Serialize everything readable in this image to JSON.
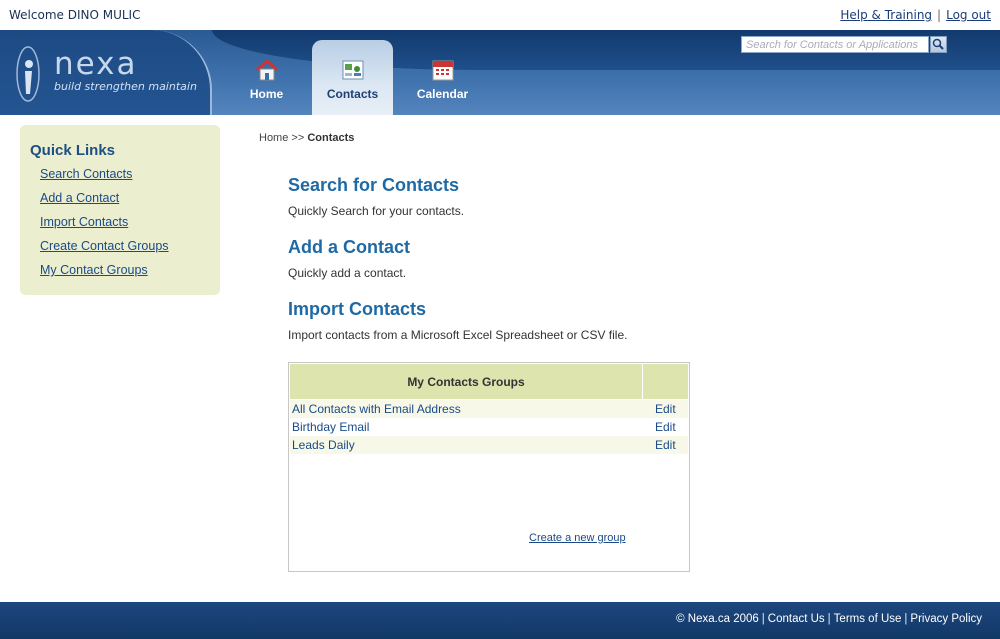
{
  "topbar": {
    "welcome": "Welcome DINO MULIC",
    "help": "Help & Training",
    "separator": "|",
    "logout": "Log out"
  },
  "header": {
    "logo_text": "nexa",
    "logo_tagline": "build strengthen maintain",
    "search_placeholder": "Search for Contacts or Applications",
    "tabs": [
      {
        "label": "Home",
        "icon": "home-icon"
      },
      {
        "label": "Contacts",
        "icon": "contacts-icon",
        "active": true
      },
      {
        "label": "Calendar",
        "icon": "calendar-icon"
      }
    ]
  },
  "sidebar": {
    "title": "Quick Links",
    "items": [
      {
        "label": "Search Contacts"
      },
      {
        "label": "Add a Contact"
      },
      {
        "label": "Import Contacts"
      },
      {
        "label": "Create Contact Groups"
      },
      {
        "label": "My Contact Groups"
      }
    ]
  },
  "breadcrumb": {
    "home": "Home",
    "arrow": ">>",
    "current": "Contacts"
  },
  "sections": [
    {
      "title": "Search for Contacts",
      "desc": "Quickly Search for your contacts."
    },
    {
      "title": "Add a Contact",
      "desc": "Quickly add a contact."
    },
    {
      "title": "Import Contacts",
      "desc": "Import contacts from a Microsoft Excel Spreadsheet or CSV file."
    }
  ],
  "groups": {
    "header": "My Contacts Groups",
    "rows": [
      {
        "name": "All Contacts with Email Address",
        "action": "Edit"
      },
      {
        "name": "Birthday Email",
        "action": "Edit"
      },
      {
        "name": "Leads Daily",
        "action": "Edit"
      }
    ],
    "create_link": "Create a new group"
  },
  "footer": {
    "copyright": "© Nexa.ca 2006",
    "links": [
      "Contact Us",
      "Terms of Use",
      "Privacy Policy"
    ],
    "separator": "|"
  },
  "colors": {
    "header_blue": "#2b5a93",
    "section_title": "#1f6aa5",
    "sidebar_bg": "#ebefd0",
    "table_header": "#dde4ae"
  }
}
